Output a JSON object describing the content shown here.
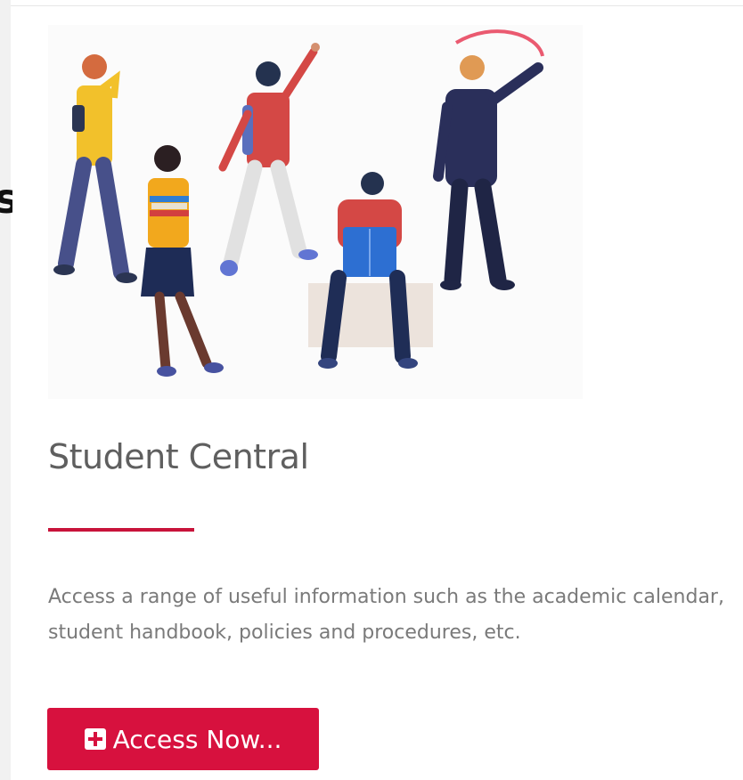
{
  "card": {
    "title": "Student Central",
    "description": "Access a range of useful information such as the academic calendar, student handbook, policies and procedures, etc.",
    "button_label": "Access Now...",
    "accent_color": "#d7113e"
  },
  "left_edge_letter": "s",
  "icons": {
    "button_icon": "plus-square-icon",
    "illustration": "students-illustration"
  }
}
